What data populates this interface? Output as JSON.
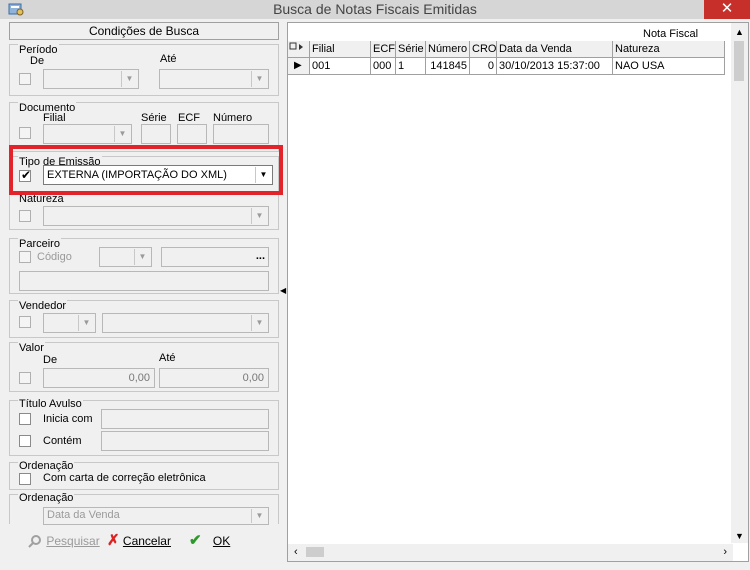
{
  "window": {
    "title": "Busca de Notas Fiscais Emitidas",
    "close_glyph": "✕"
  },
  "left_panel": {
    "header": "Condições de Busca",
    "periodo": {
      "label": "Período",
      "de": "De",
      "ate": "Até"
    },
    "documento": {
      "label": "Documento",
      "filial": "Filial",
      "serie": "Série",
      "ecf": "ECF",
      "numero": "Número"
    },
    "tipo_emissao": {
      "label": "Tipo de Emissão",
      "value": "EXTERNA (IMPORTAÇÃO DO XML)",
      "checked": true
    },
    "natureza": {
      "label": "Natureza"
    },
    "parceiro": {
      "label": "Parceiro",
      "codigo": "Código",
      "button": "..."
    },
    "vendedor": {
      "label": "Vendedor"
    },
    "valor": {
      "label": "Valor",
      "de": "De",
      "ate": "Até",
      "de_value": "0,00",
      "ate_value": "0,00"
    },
    "titulo_avulso": {
      "label": "Título Avulso",
      "inicia_com": "Inicia com",
      "contem": "Contém"
    },
    "ordenacao1": {
      "label": "Ordenação",
      "checkbox_label": "Com carta de correção eletrônica"
    },
    "ordenacao2": {
      "label": "Ordenação",
      "value": "Data da Venda"
    },
    "buttons": {
      "pesquisar": "Pesquisar",
      "cancelar": "Cancelar",
      "ok": "OK"
    }
  },
  "grid": {
    "group_header": "Nota Fiscal",
    "columns": [
      "Filial",
      "ECF",
      "Série",
      "Número",
      "CRO",
      "Data da Venda",
      "Natureza"
    ],
    "rows": [
      [
        "001",
        "000",
        "1",
        "141845",
        "0",
        "30/10/2013 15:37:00",
        "NAO USA"
      ]
    ]
  },
  "colors": {
    "highlight": "#e3232a",
    "close_button": "#c7302a"
  }
}
